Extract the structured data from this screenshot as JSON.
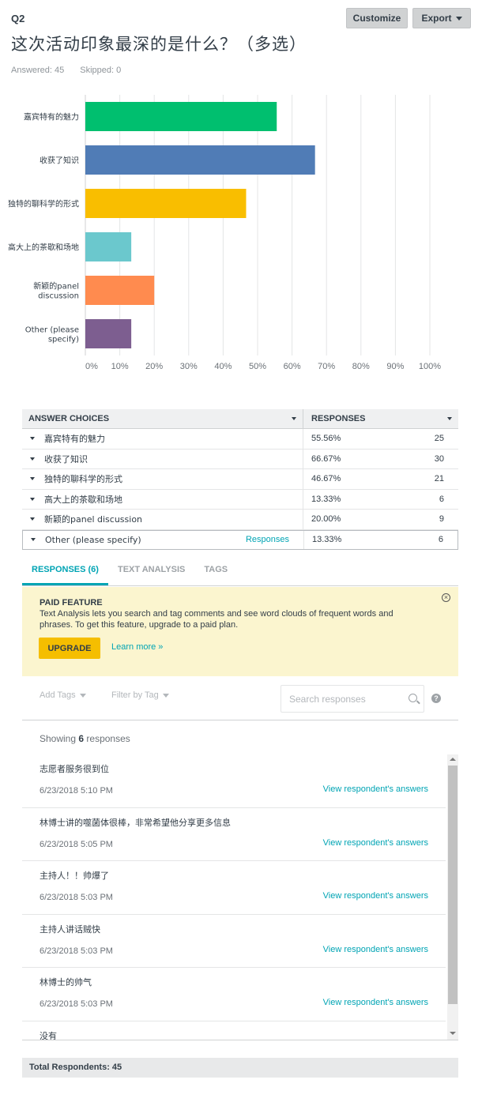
{
  "question": {
    "number": "Q2",
    "title": "这次活动印象最深的是什么？（多选）",
    "answered": "Answered: 45",
    "skipped": "Skipped: 0"
  },
  "header_buttons": {
    "customize": "Customize",
    "export": "Export"
  },
  "chart_data": {
    "type": "bar",
    "orientation": "horizontal",
    "categories": [
      "嘉宾特有的魅力",
      "收获了知识",
      "独特的聊科学的形式",
      "高大上的茶歇和场地",
      "新颖的panel discussion",
      "Other (please specify)"
    ],
    "category_lines": [
      [
        "嘉宾特有的魅力"
      ],
      [
        "收获了知识"
      ],
      [
        "独特的聊科学的形式"
      ],
      [
        "高大上的茶歇和场地"
      ],
      [
        "新颖的panel",
        "discussion"
      ],
      [
        "Other (please",
        "specify)"
      ]
    ],
    "values": [
      55.56,
      66.67,
      46.67,
      13.33,
      20.0,
      13.33
    ],
    "colors": [
      "#00bf6f",
      "#507cb6",
      "#f9be00",
      "#6bc8cd",
      "#ff8b4f",
      "#7d5e90"
    ],
    "xlim": [
      0,
      100
    ],
    "ticks": [
      "0%",
      "10%",
      "20%",
      "30%",
      "40%",
      "50%",
      "60%",
      "70%",
      "80%",
      "90%",
      "100%"
    ],
    "grid": true,
    "legend": "none"
  },
  "table": {
    "col_choice": "ANSWER CHOICES",
    "col_responses": "RESPONSES",
    "rows": [
      {
        "choice": "嘉宾特有的魅力",
        "percent": "55.56%",
        "count": "25"
      },
      {
        "choice": "收获了知识",
        "percent": "66.67%",
        "count": "30"
      },
      {
        "choice": "独特的聊科学的形式",
        "percent": "46.67%",
        "count": "21"
      },
      {
        "choice": "高大上的茶歇和场地",
        "percent": "13.33%",
        "count": "6"
      },
      {
        "choice": "新颖的panel discussion",
        "percent": "20.00%",
        "count": "9"
      },
      {
        "choice": "Other (please specify)",
        "percent": "13.33%",
        "count": "6",
        "link": "Responses"
      }
    ]
  },
  "tabs": [
    "RESPONSES (6)",
    "TEXT ANALYSIS",
    "TAGS"
  ],
  "paid_feature": {
    "title": "PAID FEATURE",
    "text": "Text Analysis lets you search and tag comments and see word clouds of frequent words and phrases. To get this feature, upgrade to a paid plan.",
    "upgrade": "UPGRADE",
    "learn_more": "Learn more »"
  },
  "toolbar": {
    "add_tags": "Add Tags",
    "filter_by_tag": "Filter by Tag",
    "search_placeholder": "Search responses",
    "help": "?"
  },
  "showing": {
    "prefix": "Showing",
    "count": "6",
    "suffix": "responses"
  },
  "responses": [
    {
      "text": "志愿者服务很到位",
      "date": "6/23/2018 5:10 PM",
      "link": "View respondent's answers"
    },
    {
      "text": "林博士讲的噬菌体很棒，非常希望他分享更多信息",
      "date": "6/23/2018 5:05 PM",
      "link": "View respondent's answers"
    },
    {
      "text": "主持人！！帅爆了",
      "date": "6/23/2018 5:03 PM",
      "link": "View respondent's answers"
    },
    {
      "text": "主持人讲话贼快",
      "date": "6/23/2018 5:03 PM",
      "link": "View respondent's answers"
    },
    {
      "text": "林博士的帅气",
      "date": "6/23/2018 5:03 PM",
      "link": "View respondent's answers"
    },
    {
      "text": "没有",
      "date": "",
      "link": ""
    }
  ],
  "total": "Total Respondents: 45"
}
